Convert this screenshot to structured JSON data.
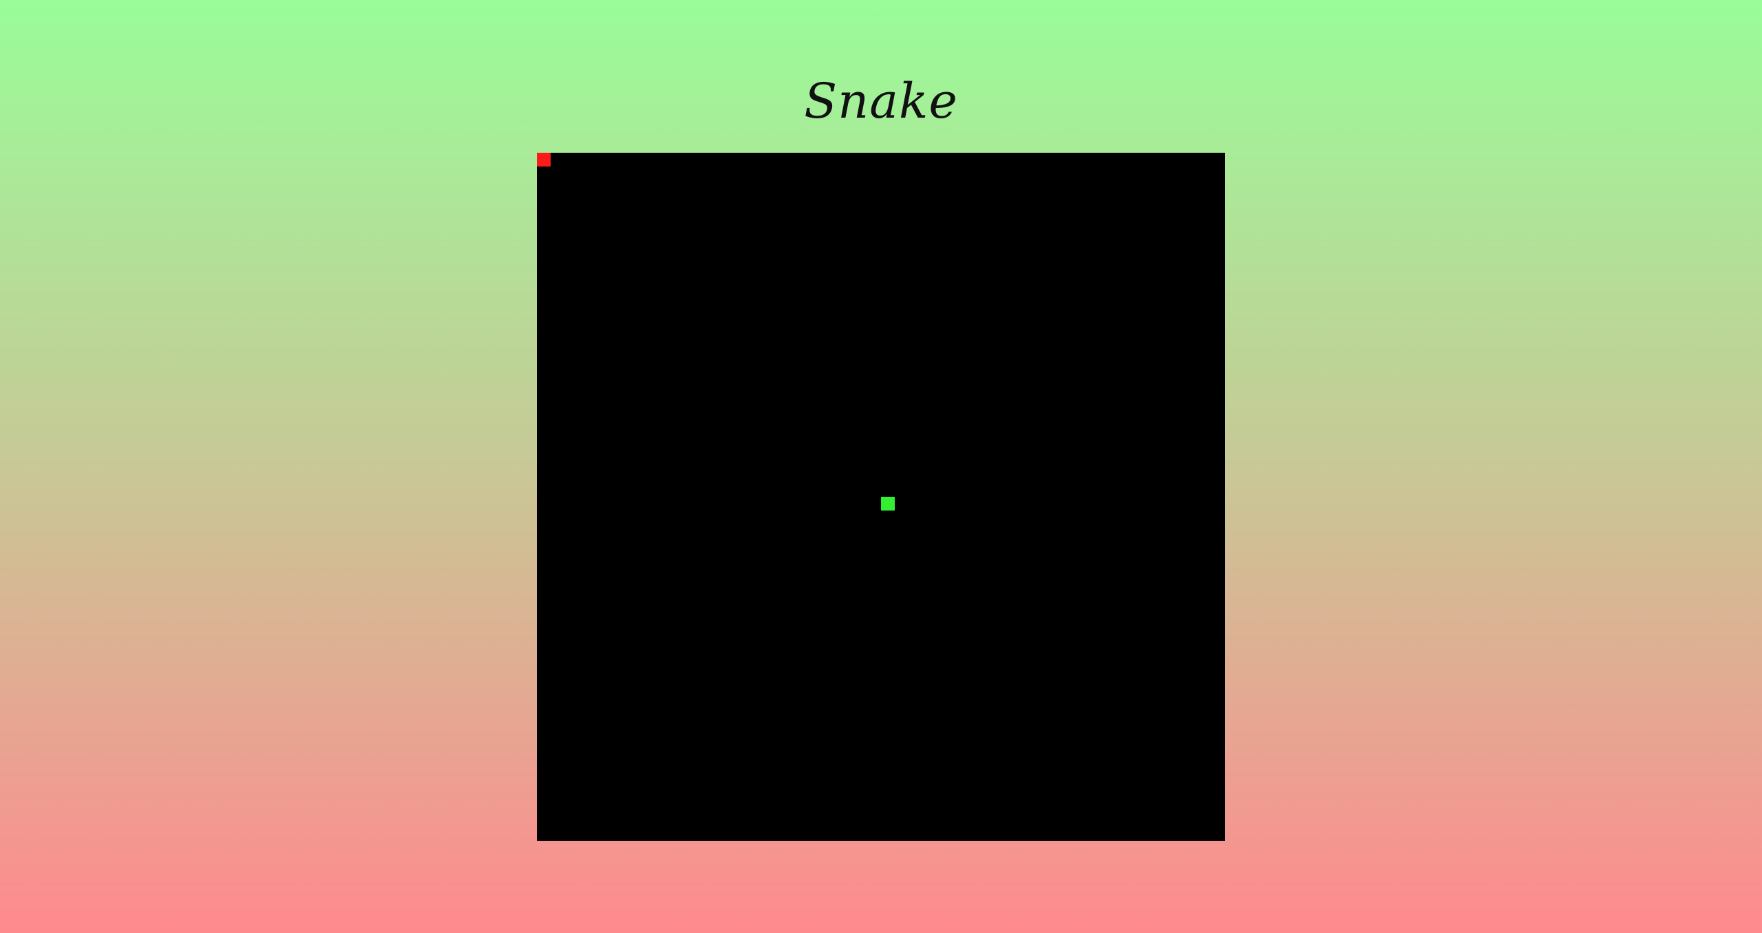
{
  "title": "Snake",
  "colors": {
    "background_top": "#99fc99",
    "background_bottom": "#ff8a8e",
    "board": "#000000",
    "snake": "#33ee33",
    "food": "#ff1a1a"
  },
  "game": {
    "grid_cols": 50,
    "grid_rows": 50,
    "snake": [
      [
        25,
        25
      ]
    ],
    "food": [
      0,
      0
    ]
  }
}
